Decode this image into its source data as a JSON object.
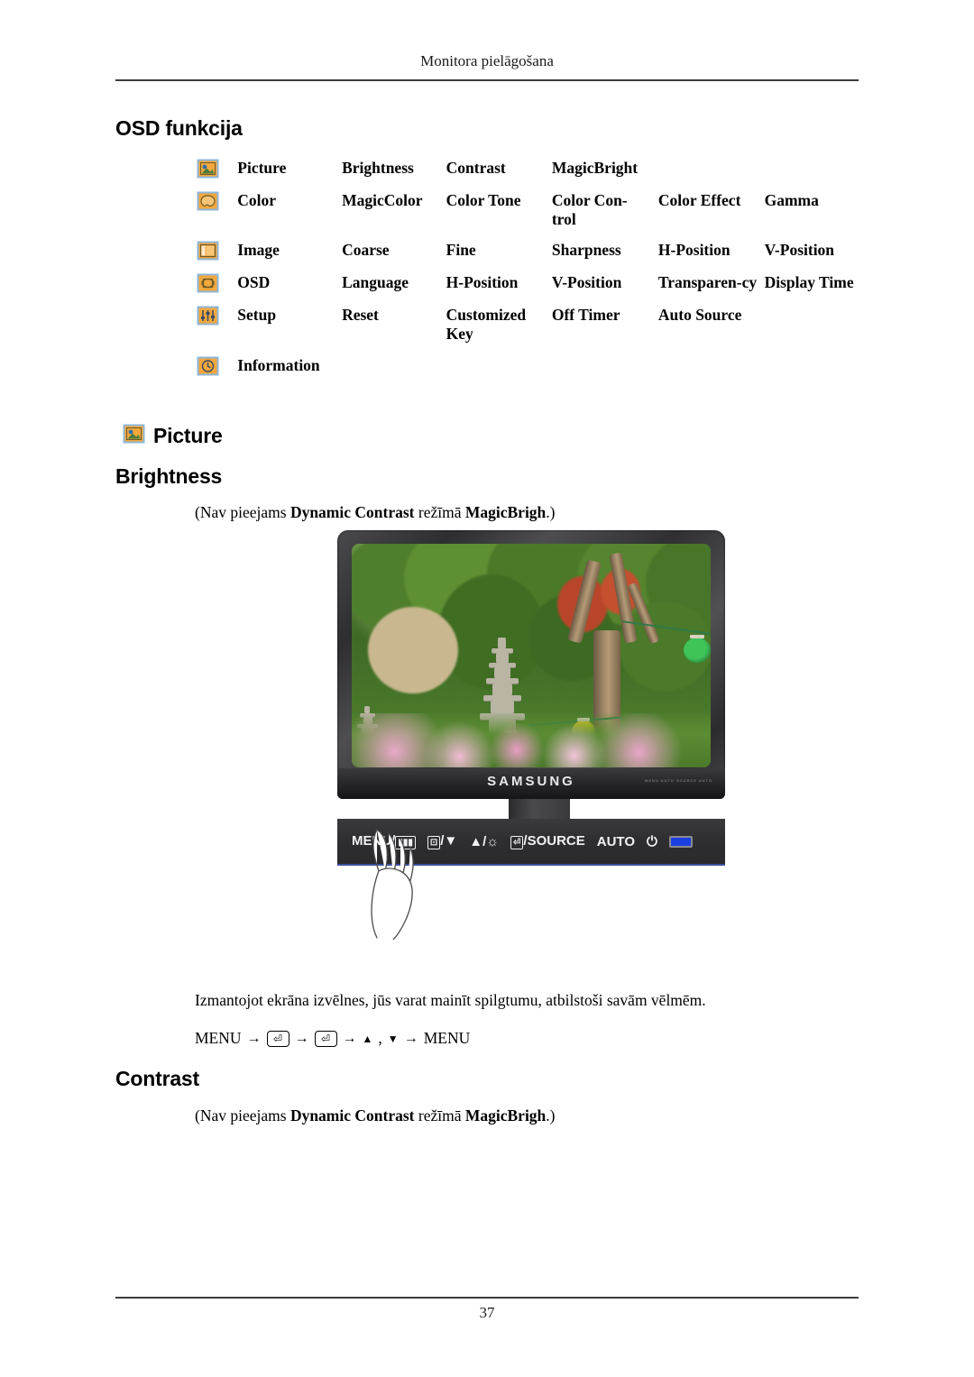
{
  "header": {
    "running_title": "Monitora pielāgošana"
  },
  "footer": {
    "page_number": "37"
  },
  "sections": {
    "osd_function_title": "OSD funkcija",
    "picture_title": "Picture",
    "brightness_title": "Brightness",
    "contrast_title": "Contrast"
  },
  "osd_table": {
    "rows": [
      {
        "icon": "picture-icon",
        "name": "Picture",
        "items": [
          "Brightness",
          "Contrast",
          "MagicBright",
          "",
          ""
        ]
      },
      {
        "icon": "color-palette-icon",
        "name": "Color",
        "items": [
          "MagicColor",
          "Color Tone",
          "Color Con-trol",
          "Color Effect",
          "Gamma"
        ]
      },
      {
        "icon": "image-panel-icon",
        "name": "Image",
        "items": [
          "Coarse",
          "Fine",
          "Sharpness",
          "H-Position",
          "V-Position"
        ]
      },
      {
        "icon": "osd-box-icon",
        "name": "OSD",
        "items": [
          "Language",
          "H-Position",
          "V-Position",
          "Transparen-cy",
          "Display Time"
        ]
      },
      {
        "icon": "sliders-icon",
        "name": "Setup",
        "items": [
          "Reset",
          "Customized Key",
          "Off Timer",
          "Auto Source",
          ""
        ]
      },
      {
        "icon": "clock-icon",
        "name": "Information",
        "items": [
          "",
          "",
          "",
          "",
          ""
        ]
      }
    ]
  },
  "brightness": {
    "note_prefix": "(Nav pieejams ",
    "note_bold1": "Dynamic Contrast",
    "note_mid": " režīmā ",
    "note_bold2": "MagicBrigh",
    "note_suffix": ".)",
    "description": "Izmantojot ekrāna izvēlnes, jūs varat mainīt spilgtumu, atbilstoši savām vēlmēm.",
    "key_sequence": {
      "start": "MENU",
      "enter1": "⏎",
      "enter2": "⏎",
      "up": "▲",
      "comma": ",",
      "down": "▼",
      "end": "MENU",
      "arrow": "→"
    }
  },
  "contrast": {
    "note_prefix": "(Nav pieejams ",
    "note_bold1": "Dynamic Contrast",
    "note_mid": " režīmā ",
    "note_bold2": "MagicBrigh",
    "note_suffix": ".)"
  },
  "monitor": {
    "brand": "SAMSUNG",
    "bezel_microlabels": "MENU AUTO SOURCE AUTO",
    "controls": [
      {
        "label": "MENU/",
        "box": "▥"
      },
      {
        "label": "/▼",
        "box": "⊡"
      },
      {
        "label": "▲/☼",
        "box": ""
      },
      {
        "label": "/SOURCE",
        "box": "⏎"
      },
      {
        "label": "AUTO",
        "box": ""
      },
      {
        "label": "⏻",
        "box": ""
      }
    ],
    "led_label": "power-led",
    "led_color": "#1a3fe0"
  },
  "colors": {
    "icon_fill": "#f2a83c",
    "icon_border": "#8fb6d8",
    "rule": "#3c3c3c",
    "led_blue": "#1a3fe0",
    "panel_dark": "#2e2e30"
  }
}
